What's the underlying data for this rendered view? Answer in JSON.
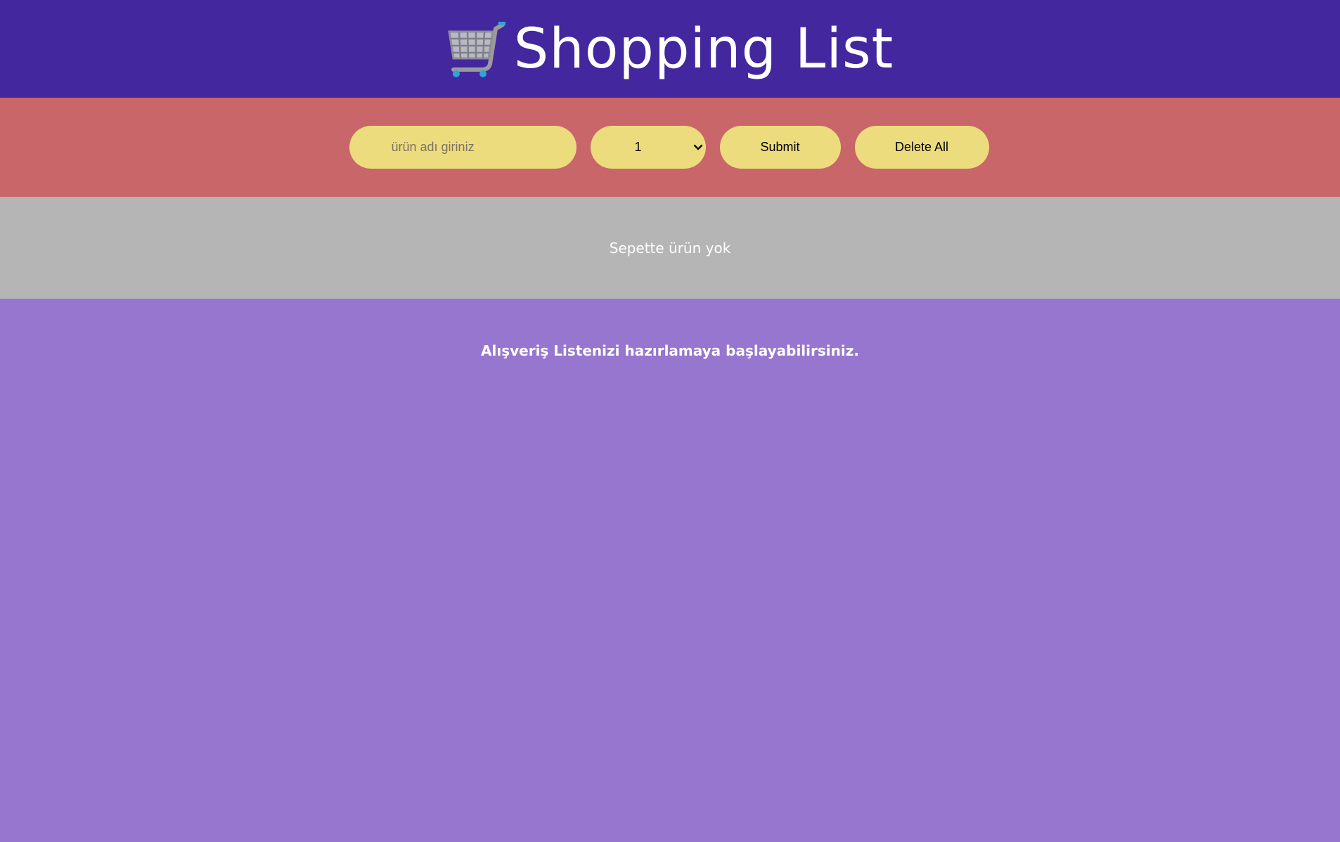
{
  "header": {
    "title": "Shopping List",
    "icon": "shopping-cart-icon"
  },
  "form": {
    "name_placeholder": "ürün adı giriniz",
    "quantity_selected": "1",
    "submit_label": "Submit",
    "delete_all_label": "Delete All"
  },
  "cart": {
    "empty_message": "Sepette ürün yok"
  },
  "main": {
    "hint": "Alışveriş Listenizi hazırlamaya başlayabilirsiniz."
  },
  "colors": {
    "header_bg": "#43279f",
    "form_bar_bg": "#c8666a",
    "pill_bg": "#eddc7d",
    "cart_bg": "#b5b5b5",
    "main_bg": "#9676cf",
    "text_light": "#ffffff"
  }
}
